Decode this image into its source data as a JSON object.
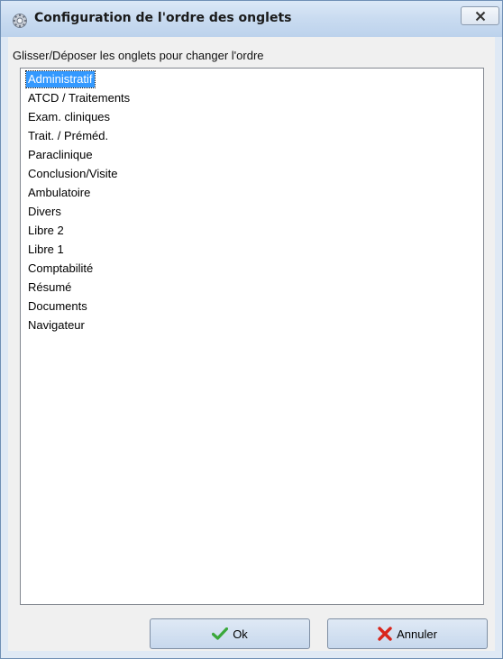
{
  "window": {
    "title": "Configuration de l'ordre des onglets",
    "close_glyph": "✕"
  },
  "instruction": "Glisser/Déposer les onglets pour changer l'ordre",
  "tabs": [
    "Administratif",
    "ATCD / Traitements",
    "Exam. cliniques",
    "Trait. / Préméd.",
    "Paraclinique",
    "Conclusion/Visite",
    "Ambulatoire",
    "Divers",
    "Libre 2",
    "Libre 1",
    "Comptabilité",
    "Résumé",
    "Documents",
    "Navigateur"
  ],
  "selected_tab": "Administratif",
  "buttons": {
    "ok_label": "Ok",
    "ok_icon": "check-icon",
    "cancel_label": "Annuler",
    "cancel_icon": "cross-icon"
  },
  "colors": {
    "selection": "#3399ff",
    "ok_check": "#3aa83a",
    "cancel_cross": "#d9261c"
  }
}
